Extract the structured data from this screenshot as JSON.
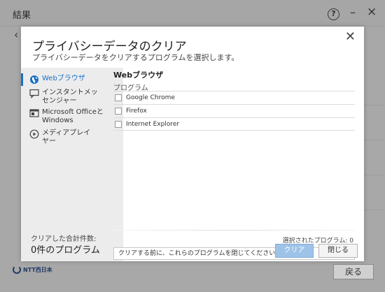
{
  "background_window": {
    "title": "結果",
    "help_icon_glyph": "?",
    "minimize_glyph": "–",
    "close_glyph": "×",
    "back_glyph": "‹",
    "footer_logo_text": "NTT西日本",
    "return_button": "戻る"
  },
  "dialog": {
    "close_glyph": "✕",
    "title": "プライバシーデータのクリア",
    "subtitle": "プライバシーデータをクリアするプログラムを選択します。",
    "sidebar": {
      "items": [
        {
          "label": "Webブラウザ",
          "icon": "globe-icon",
          "active": true
        },
        {
          "label": "インスタントメッ\nセンジャー",
          "icon": "chat-icon",
          "active": false
        },
        {
          "label": "Microsoft Officeと\nWindows",
          "icon": "window-icon",
          "active": false
        },
        {
          "label": "メディアプレイ\nヤー",
          "icon": "play-icon",
          "active": false
        }
      ],
      "total_label": "クリアした合計件数:",
      "total_value": "0件のプログラム"
    },
    "main": {
      "section_title": "Webブラウザ",
      "list_header": "プログラム",
      "programs": [
        {
          "name": "Google Chrome",
          "checked": false
        },
        {
          "name": "Firefox",
          "checked": false
        },
        {
          "name": "Internet Explorer",
          "checked": false
        }
      ],
      "selected_count": "選択されたプログラム: 0",
      "notice": "クリアする前に、これらのプログラムを閉じてください。"
    },
    "buttons": {
      "clear": "クリア",
      "close": "閉じる"
    }
  },
  "colors": {
    "accent": "#1a6fc4",
    "clear_button": "#9ec3e8",
    "backdrop": "#a8a8a8"
  }
}
